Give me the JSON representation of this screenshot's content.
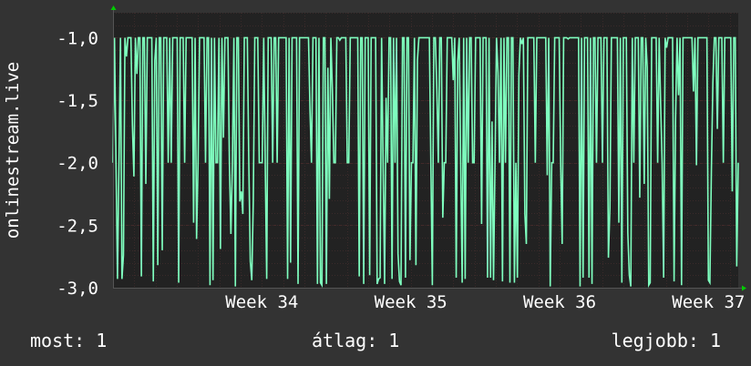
{
  "chart_data": {
    "type": "line",
    "ylabel": "onlinestream.live",
    "ylim": [
      -3.0,
      -0.8
    ],
    "y_ticks": [
      "-1,0",
      "-1,5",
      "-2,0",
      "-2,5",
      "-3,0"
    ],
    "y_tick_values": [
      -1.0,
      -1.5,
      -2.0,
      -2.5,
      -3.0
    ],
    "x_ticks": [
      "Week 34",
      "Week 35",
      "Week 36",
      "Week 37"
    ],
    "x_tick_values": [
      34,
      35,
      36,
      37
    ],
    "xlim": [
      33.0,
      37.2
    ],
    "grid": true,
    "colors": {
      "background": "#333333",
      "plot_background": "#222222",
      "grid": "#4a2a2a",
      "line": "#7fffbf",
      "axis_arrow": "#00cc00"
    },
    "series": [
      {
        "values": []
      }
    ]
  },
  "footer": {
    "now_label": "most:",
    "now_value": "1",
    "avg_label": "átlag:",
    "avg_value": "1",
    "best_label": "legjobb:",
    "best_value": "1"
  }
}
